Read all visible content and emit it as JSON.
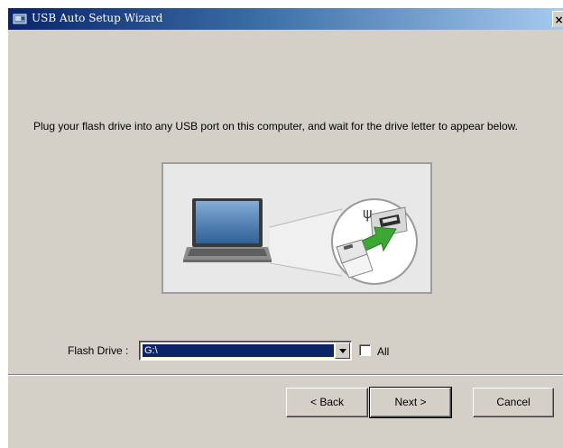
{
  "window": {
    "title": "USB Auto Setup Wizard",
    "close_glyph": "×",
    "icon": "usb-app-icon"
  },
  "main": {
    "instruction": "Plug your flash drive into any USB port on this computer, and wait for the drive letter to appear below.",
    "illustration": "laptop-usb-plug-illustration"
  },
  "drive": {
    "label": "Flash Drive :",
    "selected": "G:\\",
    "all_label": "All",
    "all_checked": false
  },
  "buttons": {
    "back": "< Back",
    "next": "Next >",
    "cancel": "Cancel"
  },
  "colors": {
    "title_bar_start": "#0a246a",
    "title_bar_end": "#a6caf0",
    "dialog_bg": "#d4d0c8",
    "selection": "#0a246a",
    "arrow_green": "#3aa832"
  }
}
